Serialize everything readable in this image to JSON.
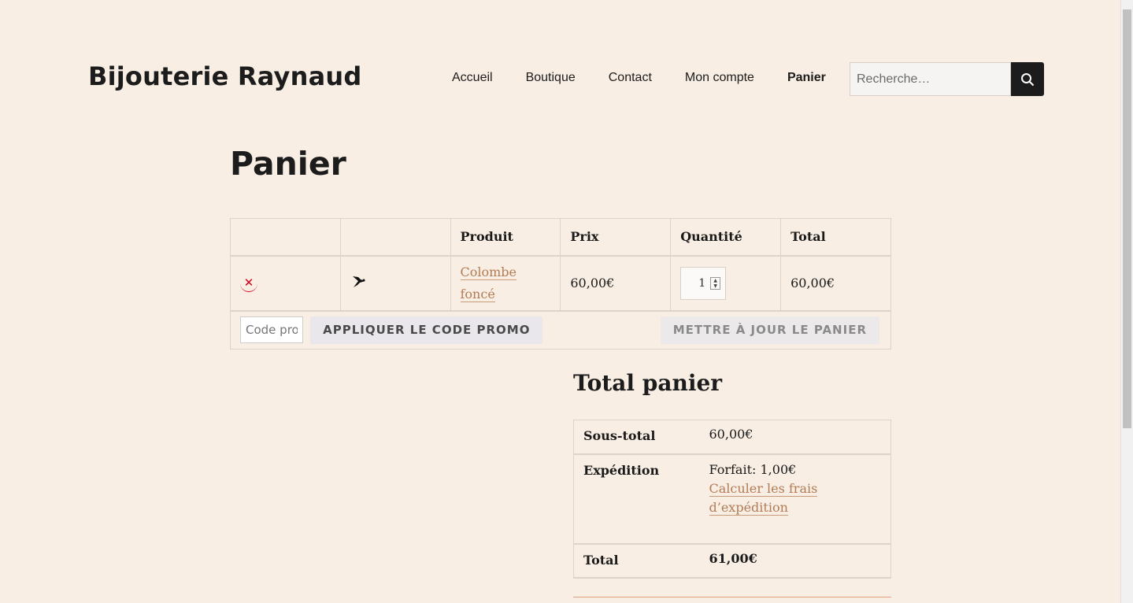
{
  "site": {
    "title": "Bijouterie Raynaud"
  },
  "nav": [
    "Accueil",
    "Boutique",
    "Contact",
    "Mon compte",
    "Panier"
  ],
  "search": {
    "placeholder": "Recherche…",
    "icon": "search-icon"
  },
  "page": {
    "title": "Panier"
  },
  "cart": {
    "headers": [
      "",
      "",
      "Produit",
      "Prix",
      "Quantité",
      "Total"
    ],
    "item": {
      "remove_icon": "remove-icon",
      "thumbnail_icon": "dove-icon",
      "product_line1": "Colombe",
      "product_line2": "foncé",
      "price": "60,00€",
      "quantity": "1",
      "total": "60,00€"
    },
    "coupon": {
      "placeholder": "Code promo",
      "apply_label": "APPLIQUER LE CODE PROMO"
    },
    "update_label": "METTRE À JOUR LE PANIER"
  },
  "totals": {
    "title": "Total panier",
    "subtotal_label": "Sous-total",
    "subtotal_value": "60,00€",
    "shipping_label": "Expédition",
    "shipping_value": "Forfait: 1,00€",
    "shipping_link_line1": "Calculer les frais",
    "shipping_link_line2": "d’expédition",
    "total_label": "Total",
    "total_value": "61,00€"
  },
  "colors": {
    "background": "#f8eee3",
    "link": "#b37b55",
    "remove": "#d0021b"
  }
}
